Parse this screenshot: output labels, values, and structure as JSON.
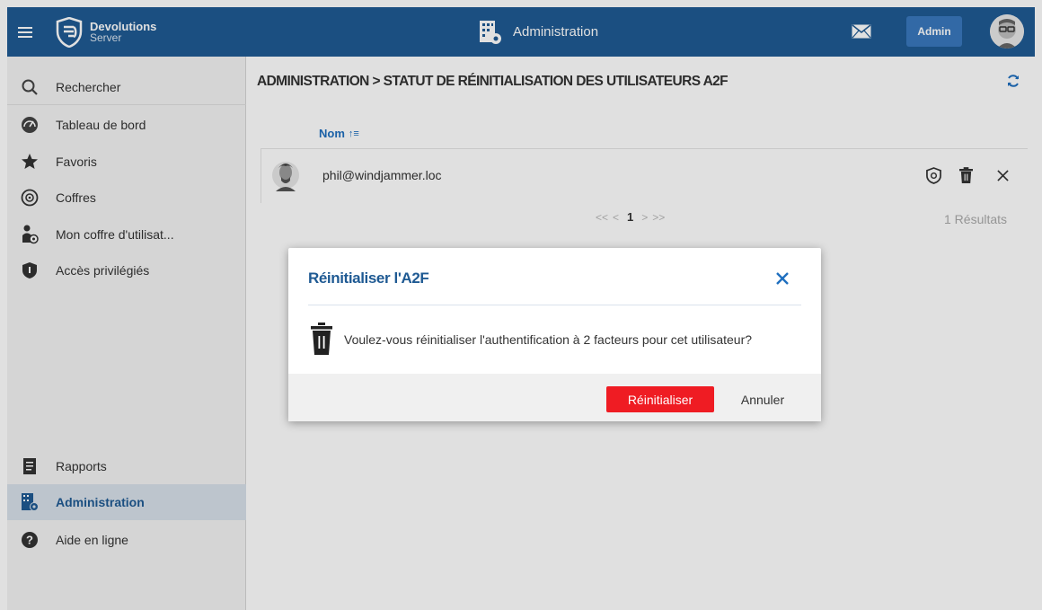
{
  "topbar": {
    "brand_name": "Devolutions",
    "brand_sub": "Server",
    "section_title": "Administration",
    "user_button": "Admin",
    "bg_color": "#1f5a93"
  },
  "sidebar": {
    "items": [
      {
        "label": "Rechercher",
        "icon": "search-icon"
      },
      {
        "label": "Tableau de bord",
        "icon": "dashboard-icon"
      },
      {
        "label": "Favoris",
        "icon": "star-icon"
      },
      {
        "label": "Coffres",
        "icon": "vault-icon"
      },
      {
        "label": "Mon coffre d'utilisat...",
        "icon": "user-vault-icon"
      },
      {
        "label": "Accès privilégiés",
        "icon": "shield-icon"
      },
      {
        "label": "Rapports",
        "icon": "reports-icon"
      },
      {
        "label": "Administration",
        "icon": "administration-icon",
        "active": true
      },
      {
        "label": "Aide en ligne",
        "icon": "help-icon"
      }
    ]
  },
  "main": {
    "breadcrumb": "ADMINISTRATION  >  STATUT DE RÉINITIALISATION DES UTILISATEURS A2F",
    "column_header": "Nom",
    "sort_indicator": "↑≡",
    "rows": [
      {
        "email": "phil@windjammer.loc"
      }
    ],
    "pager": {
      "first": "<<",
      "prev": "<",
      "current": "1",
      "next": ">",
      "last": ">>"
    },
    "results": "1 Résultats"
  },
  "modal": {
    "title": "Réinitialiser l'A2F",
    "message": "Voulez-vous réinitialiser l'authentification à 2 facteurs pour cet utilisateur?",
    "confirm_label": "Réinitialiser",
    "cancel_label": "Annuler",
    "confirm_color": "#ef1c23"
  }
}
